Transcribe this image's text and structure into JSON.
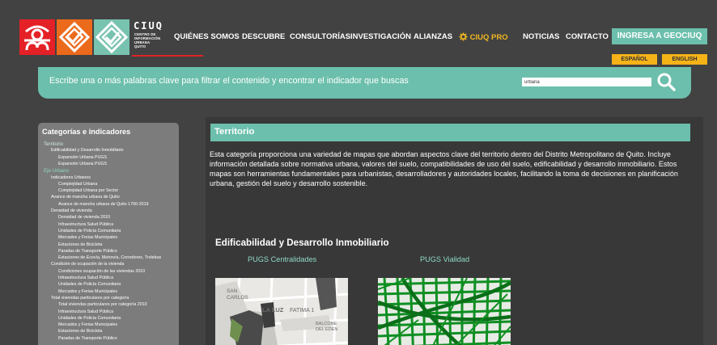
{
  "brand": {
    "short": "CIUQ",
    "lines": [
      "CENTRO DE",
      "INFORMACIÓN",
      "URBANA",
      "QUITO"
    ],
    "colors": {
      "red": "#e42127",
      "orange": "#ec6a1c",
      "teal": "#78c2b0",
      "accent": "#6cbfac",
      "yellow": "#f5b318"
    }
  },
  "nav": {
    "items": [
      "QUIÉNES SOMOS",
      "DESCUBRE",
      "CONSULTORÍAS",
      "INVESTIGACIÓN",
      "ALIANZAS",
      "CIUQ PRO",
      "NOTICIAS",
      "CONTACTO"
    ],
    "login": "INGRESA A GEOCIUQ",
    "languages": [
      "ESPAÑOL",
      "ENGLISH"
    ]
  },
  "search": {
    "hint": "Escribe una o más palabras clave para filtrar el contenido y encontrar el indicador que buscas",
    "value": "urbana"
  },
  "sidebar": {
    "title": "Categorías e indicadores",
    "items": [
      {
        "label": "Territorio",
        "level": 0
      },
      {
        "label": "Edificabilidad y Desarrollo Inmobiliario",
        "level": 1
      },
      {
        "label": "Expansión Urbana PUGS",
        "level": 2
      },
      {
        "label": "Expansión Urbana PUGS",
        "level": 2
      },
      {
        "label": "Eje Urbano",
        "level": 0
      },
      {
        "label": "Indicadores Urbanos",
        "level": 1
      },
      {
        "label": "Complejidad Urbana",
        "level": 2
      },
      {
        "label": "Complejidad Urbana por Sector",
        "level": 2
      },
      {
        "label": "Avance de mancha urbana de Quito",
        "level": 1
      },
      {
        "label": "Avance de mancha urbana de Quito 1760-2019",
        "level": 2
      },
      {
        "label": "Densidad de vivienda",
        "level": 1
      },
      {
        "label": "Densidad de vivienda 2010",
        "level": 2
      },
      {
        "label": "Infraestructura Salud Pública",
        "level": 2
      },
      {
        "label": "Unidades de Policía Comunitaria",
        "level": 2
      },
      {
        "label": "Mercados y Ferias Municipales",
        "level": 2
      },
      {
        "label": "Estaciones de Bicicleta",
        "level": 2
      },
      {
        "label": "Paradas de Transporte Público",
        "level": 2
      },
      {
        "label": "Estaciones de Ecovía, Metrovía, Corredores, Trolebus",
        "level": 2
      },
      {
        "label": "Condición de ocupación de la vivienda",
        "level": 1
      },
      {
        "label": "Condiciones ocupación de las viviendas 2010",
        "level": 2
      },
      {
        "label": "Infraestructura Salud Pública",
        "level": 2
      },
      {
        "label": "Unidades de Policía Comunitaria",
        "level": 2
      },
      {
        "label": "Mercados y Ferias Municipales",
        "level": 2
      },
      {
        "label": "Total viviendas particulares por categoría",
        "level": 1
      },
      {
        "label": "Total viviendas particulares por categoría 2010",
        "level": 2
      },
      {
        "label": "Infraestructura Salud Pública",
        "level": 2
      },
      {
        "label": "Unidades de Policía Comunitaria",
        "level": 2
      },
      {
        "label": "Mercados y Ferias Municipales",
        "level": 2
      },
      {
        "label": "Estaciones de Bicicleta",
        "level": 2
      },
      {
        "label": "Paradas de Transporte Público",
        "level": 2
      }
    ]
  },
  "main": {
    "category": "Territorio",
    "description": "Esta categoría proporciona una variedad de mapas que abordan aspectos clave del territorio dentro del Distrito Metropolitano de Quito. Incluye información detallada sobre normativa urbana, valores del suelo, compatibilidades de uso del suelo, edificabilidad y desarrollo inmobiliario. Estos mapas son herramientas fundamentales para urbanistas, desarrolladores y autoridades locales, facilitando la toma de decisiones en planificación urbana, gestión del suelo y desarrollo sostenible.",
    "section": "Edificabilidad y Desarrollo Inmobiliario",
    "maps": [
      {
        "title": "PUGS Centralidades",
        "labels": [
          "SAN",
          "CARLOS",
          "LA LUZ",
          "FATIMA 1",
          "BALCONE",
          "DEL EDEN"
        ]
      },
      {
        "title": "PUGS Vialidad"
      }
    ]
  }
}
